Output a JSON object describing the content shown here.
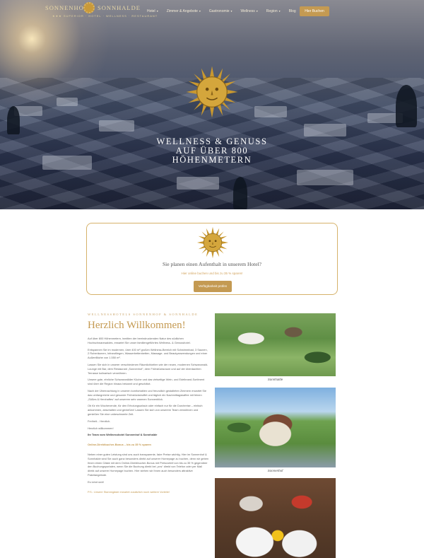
{
  "nav": {
    "brand_left": "SONNENHOF",
    "brand_right": "SONNHALDE",
    "tagline": "★★★ SUPERIOR · HOTEL · WELLNESS · RESTAURANT",
    "items": [
      {
        "label": "Hotel"
      },
      {
        "label": "Zimmer & Angebote"
      },
      {
        "label": "Gastronomie"
      },
      {
        "label": "Wellness"
      },
      {
        "label": "Region"
      },
      {
        "label": "Blog"
      }
    ],
    "book_label": "Hier Buchen"
  },
  "hero": {
    "title_line1": "WELLNESS & GENUSS",
    "title_line2": "AUF ÜBER 800",
    "title_line3": "HÖHENMETERN"
  },
  "booking": {
    "title": "Sie planen einen Aufenthalt in unserem Hotel?",
    "subtitle": "Hier online buchen und bis zu 35 % sparen!",
    "button_label": "Verfügbarkeit prüfen"
  },
  "welcome": {
    "kicker": "WELLNESSHOTELS SONNENHOF & SONNHALDE",
    "title": "Herzlich Willkommen!",
    "paragraphs": [
      "Auf über 800 Höhenmetern, inmitten der beeindruckenden Natur des südlichen Hochschwarzwaldes, erwartet Sie unser familiengeführtes Wellness- & Genusshotel.",
      "Entspannen Sie im modernen, über 400 m² großen Wellness-Bereich mit Schwimmbad, 3 Saunen, 2 Ruheräumen, Infrarotliegen, Wasserbettenbetten, Massage- und Beautyanwendungen und einer Außenfläche von 1.550 m².",
      "Lassen Sie sich in unserer verschiedenen Räumlichkeiten wie der neuen, modernen Schwarzwald-Lounge mit Bar, dem Restaurant „Sonnenhof“, dem Frühstücksraum und auf der überdachten Terrasse kulinarisch verwöhnen.",
      "Unsere gute, ehrliche Schwarzwälder Küche und das vielseitige Wein- und Edelbrand-Sortiment sind über die Region hinaus bekannt und geschätzt.",
      "Nach der Übernachtung in unseren komfortablen und freundlich gestalteten Zimmern erwartet Sie das umfangreiche und gesunde Frühstücksbuffet und täglich ein Nachmittagskaffee mit feinen „Süßes & Herzhaftes“ auf unserem sehr warmen Sonnenblick.",
      "Ob für ein Wochenende, für den Erholungsurlaub oder einfach nur für die Durchreise – einfach ankommen, abschalten und genießen! Lassen Sie sich von unserem Team verwöhnen und genießen Sie eine unbeschwerte Zeit.",
      "Freiheit... Herzlich.",
      "Herzlich willkommen!"
    ],
    "signature": "Ihr Team vom Wellnesshotel Sonnenhof & Sonnhalde",
    "bonus_heading": "Online-Direktbucher-Bonus – bis zu 35 % sparen",
    "bonus_text": "Neben einer guten Leistung sind uns auch transparente, faire Preise wichtig. Hier im Sonnenhof & Sonnhalde sind Sie auch ganz besonders direkt auf unserer Homepage zu buchen, denn wir geben Ihnen einen Gäste mit dem Online-Direktbucher-Bonus mit Preisvorteil von bis zu 35 % gegenüber den Buchungsportalen, wenn Sie die Buchung direkt bei „uns“ direkt von Telefon oder per Mail direkt auf unserer Homepage buchen. Hier stehen wir Ihnen auch besonders attraktive Paketangebote.",
    "closing": "Es lohnt sich!",
    "ps": "P.S.: Unsere Stammgäste erwartet zusätzlich noch weitere Vorteile!"
  },
  "photos": [
    {
      "caption": "Sonnhalde"
    },
    {
      "caption": "Sonnenhof"
    }
  ],
  "colors": {
    "accent_gold": "#c49a52",
    "hero_dark": "#1e2438"
  }
}
